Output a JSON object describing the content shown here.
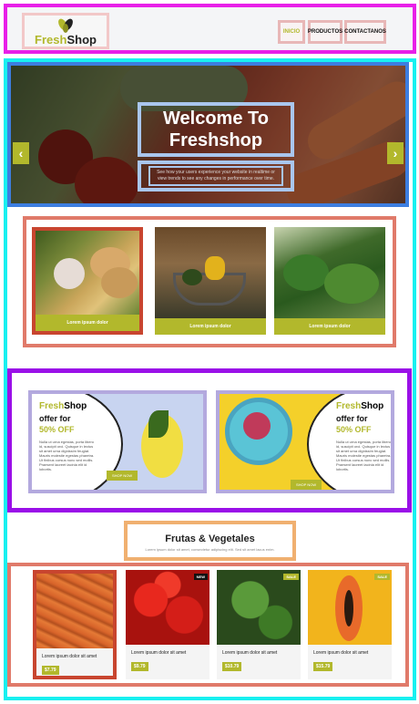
{
  "header": {
    "logo": {
      "text_green": "Fresh",
      "text_dark": "Shop"
    },
    "nav": [
      {
        "label": "INICIO"
      },
      {
        "label": "PRODUCTOS"
      },
      {
        "label": "CONTACTANOS"
      }
    ]
  },
  "hero": {
    "title": "Welcome To Freshshop",
    "subtitle": "See how your users experience your website in realtime or view trends to see any changes in performance over time.",
    "prev": "‹",
    "next": "›"
  },
  "categories": [
    {
      "label": "Lorem ipsum dolor"
    },
    {
      "label": "Lorem ipsum dolor"
    },
    {
      "label": "Lorem ipsum dolor"
    }
  ],
  "promos": [
    {
      "brand_green": "Fresh",
      "brand_dark": "Shop",
      "offer": "offer for",
      "discount": "50% OFF",
      "text": "Nulla ut urna egestas, porta libero id, suscipit orci. Quisque in lectus sit amet urna dignissim feugiat. Mauris molestie egestas pharetra. Ut finibus cursus nunc sed mollis. Praesent laoreet lacinia elit id lobortis.",
      "button": "SHOP NOW"
    },
    {
      "brand_green": "Fresh",
      "brand_dark": "Shop",
      "offer": "offer for",
      "discount": "50% OFF",
      "text": "Nulla ut urna egestas, porta libero id, suscipit orci. Quisque in lectus sit amet urna dignissim feugiat. Mauris molestie egestas pharetra. Ut finibus cursus nunc sed mollis. Praesent laoreet lacinia elit id lobortis.",
      "button": "SHOP NOW"
    }
  ],
  "section": {
    "title": "Frutas & Vegetales",
    "subtitle": "Lorem ipsum dolor sit amet, consectetur adipiscing elit. Sed sit amet lacus enim."
  },
  "products": [
    {
      "name": "Lorem ipsum dolor sit amet",
      "price": "$7.79",
      "tag": ""
    },
    {
      "name": "Lorem ipsum dolor sit amet",
      "price": "$9.79",
      "tag": "NEW"
    },
    {
      "name": "Lorem ipsum dolor sit amet",
      "price": "$10.79",
      "tag": "SALE"
    },
    {
      "name": "Lorem ipsum dolor sit amet",
      "price": "$15.79",
      "tag": "SALE"
    }
  ],
  "colors": {
    "accent": "#b2b82c",
    "new_tag": "#111111",
    "sale_tag": "#b2b82c"
  }
}
